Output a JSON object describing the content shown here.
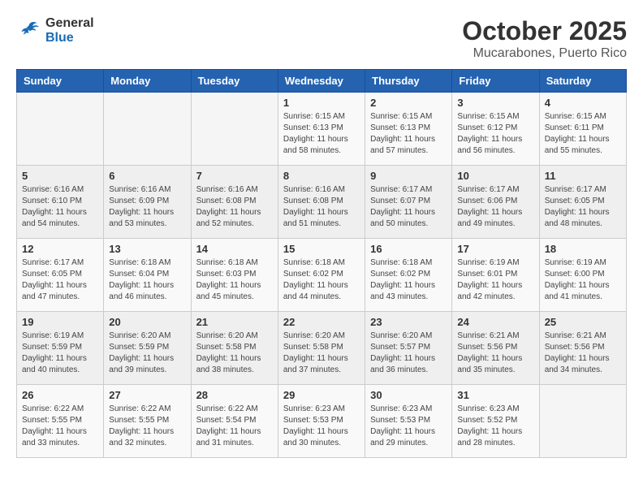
{
  "header": {
    "logo_line1": "General",
    "logo_line2": "Blue",
    "month": "October 2025",
    "location": "Mucarabones, Puerto Rico"
  },
  "weekdays": [
    "Sunday",
    "Monday",
    "Tuesday",
    "Wednesday",
    "Thursday",
    "Friday",
    "Saturday"
  ],
  "weeks": [
    [
      {
        "day": "",
        "info": ""
      },
      {
        "day": "",
        "info": ""
      },
      {
        "day": "",
        "info": ""
      },
      {
        "day": "1",
        "info": "Sunrise: 6:15 AM\nSunset: 6:13 PM\nDaylight: 11 hours\nand 58 minutes."
      },
      {
        "day": "2",
        "info": "Sunrise: 6:15 AM\nSunset: 6:13 PM\nDaylight: 11 hours\nand 57 minutes."
      },
      {
        "day": "3",
        "info": "Sunrise: 6:15 AM\nSunset: 6:12 PM\nDaylight: 11 hours\nand 56 minutes."
      },
      {
        "day": "4",
        "info": "Sunrise: 6:15 AM\nSunset: 6:11 PM\nDaylight: 11 hours\nand 55 minutes."
      }
    ],
    [
      {
        "day": "5",
        "info": "Sunrise: 6:16 AM\nSunset: 6:10 PM\nDaylight: 11 hours\nand 54 minutes."
      },
      {
        "day": "6",
        "info": "Sunrise: 6:16 AM\nSunset: 6:09 PM\nDaylight: 11 hours\nand 53 minutes."
      },
      {
        "day": "7",
        "info": "Sunrise: 6:16 AM\nSunset: 6:08 PM\nDaylight: 11 hours\nand 52 minutes."
      },
      {
        "day": "8",
        "info": "Sunrise: 6:16 AM\nSunset: 6:08 PM\nDaylight: 11 hours\nand 51 minutes."
      },
      {
        "day": "9",
        "info": "Sunrise: 6:17 AM\nSunset: 6:07 PM\nDaylight: 11 hours\nand 50 minutes."
      },
      {
        "day": "10",
        "info": "Sunrise: 6:17 AM\nSunset: 6:06 PM\nDaylight: 11 hours\nand 49 minutes."
      },
      {
        "day": "11",
        "info": "Sunrise: 6:17 AM\nSunset: 6:05 PM\nDaylight: 11 hours\nand 48 minutes."
      }
    ],
    [
      {
        "day": "12",
        "info": "Sunrise: 6:17 AM\nSunset: 6:05 PM\nDaylight: 11 hours\nand 47 minutes."
      },
      {
        "day": "13",
        "info": "Sunrise: 6:18 AM\nSunset: 6:04 PM\nDaylight: 11 hours\nand 46 minutes."
      },
      {
        "day": "14",
        "info": "Sunrise: 6:18 AM\nSunset: 6:03 PM\nDaylight: 11 hours\nand 45 minutes."
      },
      {
        "day": "15",
        "info": "Sunrise: 6:18 AM\nSunset: 6:02 PM\nDaylight: 11 hours\nand 44 minutes."
      },
      {
        "day": "16",
        "info": "Sunrise: 6:18 AM\nSunset: 6:02 PM\nDaylight: 11 hours\nand 43 minutes."
      },
      {
        "day": "17",
        "info": "Sunrise: 6:19 AM\nSunset: 6:01 PM\nDaylight: 11 hours\nand 42 minutes."
      },
      {
        "day": "18",
        "info": "Sunrise: 6:19 AM\nSunset: 6:00 PM\nDaylight: 11 hours\nand 41 minutes."
      }
    ],
    [
      {
        "day": "19",
        "info": "Sunrise: 6:19 AM\nSunset: 5:59 PM\nDaylight: 11 hours\nand 40 minutes."
      },
      {
        "day": "20",
        "info": "Sunrise: 6:20 AM\nSunset: 5:59 PM\nDaylight: 11 hours\nand 39 minutes."
      },
      {
        "day": "21",
        "info": "Sunrise: 6:20 AM\nSunset: 5:58 PM\nDaylight: 11 hours\nand 38 minutes."
      },
      {
        "day": "22",
        "info": "Sunrise: 6:20 AM\nSunset: 5:58 PM\nDaylight: 11 hours\nand 37 minutes."
      },
      {
        "day": "23",
        "info": "Sunrise: 6:20 AM\nSunset: 5:57 PM\nDaylight: 11 hours\nand 36 minutes."
      },
      {
        "day": "24",
        "info": "Sunrise: 6:21 AM\nSunset: 5:56 PM\nDaylight: 11 hours\nand 35 minutes."
      },
      {
        "day": "25",
        "info": "Sunrise: 6:21 AM\nSunset: 5:56 PM\nDaylight: 11 hours\nand 34 minutes."
      }
    ],
    [
      {
        "day": "26",
        "info": "Sunrise: 6:22 AM\nSunset: 5:55 PM\nDaylight: 11 hours\nand 33 minutes."
      },
      {
        "day": "27",
        "info": "Sunrise: 6:22 AM\nSunset: 5:55 PM\nDaylight: 11 hours\nand 32 minutes."
      },
      {
        "day": "28",
        "info": "Sunrise: 6:22 AM\nSunset: 5:54 PM\nDaylight: 11 hours\nand 31 minutes."
      },
      {
        "day": "29",
        "info": "Sunrise: 6:23 AM\nSunset: 5:53 PM\nDaylight: 11 hours\nand 30 minutes."
      },
      {
        "day": "30",
        "info": "Sunrise: 6:23 AM\nSunset: 5:53 PM\nDaylight: 11 hours\nand 29 minutes."
      },
      {
        "day": "31",
        "info": "Sunrise: 6:23 AM\nSunset: 5:52 PM\nDaylight: 11 hours\nand 28 minutes."
      },
      {
        "day": "",
        "info": ""
      }
    ]
  ]
}
